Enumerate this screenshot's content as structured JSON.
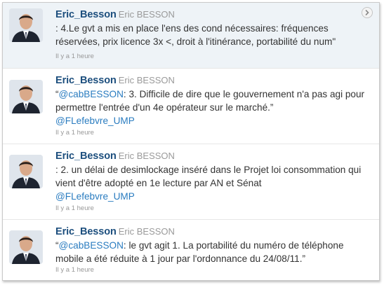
{
  "colors": {
    "screen_name": "#1d4f7e",
    "full_name": "#9a9a9a",
    "mention_link": "#2a7cc0",
    "tweet_text": "#333333",
    "active_background": "#eef3f7"
  },
  "tweets": [
    {
      "screen_name": "Eric_Besson",
      "full_name": "Eric BESSON",
      "text": ": 4.Le gvt a mis en place l'ens des cond nécessaires: fréquences réservées, prix licence 3x <, droit à l'itinérance, portabilité du num\"",
      "time": "Il y a 1 heure",
      "has_expand_icon": true
    },
    {
      "screen_name": "Eric_Besson",
      "full_name": "Eric BESSON",
      "text_prefix": "“",
      "mention": "@cabBESSON",
      "text_rest": ": 3. Difficile de dire que le gouvernement n'a pas agi pour permettre l'entrée d'un 4e opérateur sur le marché.”",
      "trailing_mention": "@FLefebvre_UMP",
      "time": "Il y a 1 heure"
    },
    {
      "screen_name": "Eric_Besson",
      "full_name": "Eric BESSON",
      "text": ": 2. un délai de desimlockage inséré dans le Projet loi consommation qui vient d'être adopté en 1e lecture par AN et Sénat",
      "trailing_mention": "@FLefebvre_UMP",
      "time": "Il y a 1 heure"
    },
    {
      "screen_name": "Eric_Besson",
      "full_name": "Eric BESSON",
      "text_prefix": "“",
      "mention": "@cabBESSON",
      "text_rest": ": le gvt agit 1. La portabilité du numéro de téléphone mobile a été réduite à 1 jour par l'ordonnance du 24/08/11.”",
      "time": "Il y a 1 heure"
    }
  ]
}
